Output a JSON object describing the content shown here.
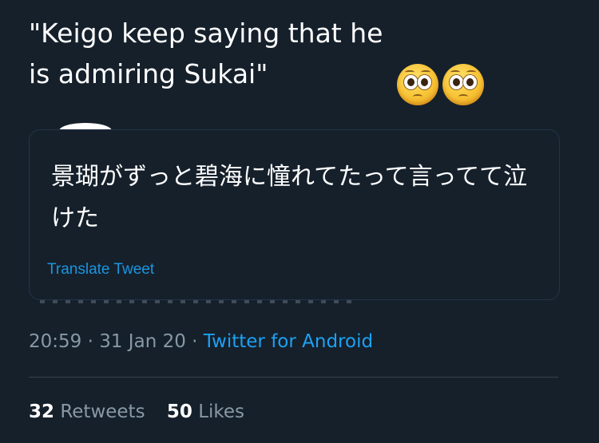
{
  "tweet": {
    "text": "\"Keigo keep saying that he is admiring Sukai\"",
    "emojis": [
      "pleading-face-icon",
      "pleading-face-icon"
    ]
  },
  "quoted_tweet": {
    "text": "景瑚がずっと碧海に憧れてたって言ってて泣けた",
    "translate_label": "Translate Tweet"
  },
  "meta": {
    "time": "20:59",
    "separator": " · ",
    "date": "31 Jan 20",
    "source": "Twitter for Android"
  },
  "stats": {
    "retweets_count": "32",
    "retweets_label": "Retweets",
    "likes_count": "50",
    "likes_label": "Likes"
  },
  "colors": {
    "background": "#15202b",
    "text": "#ffffff",
    "secondary_text": "#8899a6",
    "link": "#1da1f2",
    "border": "#38444d"
  }
}
